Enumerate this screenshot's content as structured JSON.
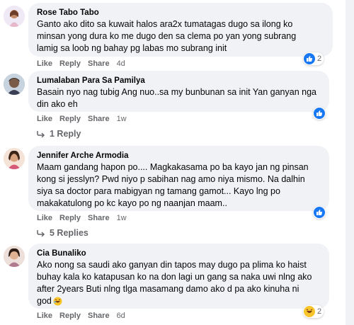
{
  "comments": [
    {
      "author": "Rose Tabo Tabo",
      "lines": [
        "Ganto ako dito sa kuwait halos ara2x tumatagas dugo sa ilong ko",
        "minsan yong dura ko me dugo den sa clema po yan yong subrang",
        "lamig sa loob ng bahay pg labas mo subrang init"
      ],
      "actions": {
        "like": "Like",
        "reply": "Reply",
        "share": "Share",
        "time": "4d"
      },
      "reaction_icons": [
        "like-icon",
        "heart-icon"
      ],
      "reaction_count": "2"
    },
    {
      "author": "Lumalaban Para Sa Pamilya",
      "lines": [
        "Basain nyo nag tubig Ang nuo..sa my bunbunan sa init Yan ganyan nga",
        "din ako eh"
      ],
      "actions": {
        "like": "Like",
        "reply": "Reply",
        "share": "Share",
        "time": "1w"
      },
      "reaction_icons": [
        "like-icon"
      ],
      "replies_label": "1 Reply"
    },
    {
      "author": "Jennifer Arche Armodia",
      "lines": [
        "Maam gandang hapon po.... Magkakasama po ba kayo jan ng pinsan",
        "kong si jesslyn? Pwd niyo p sabihan nag amo niya mismo. Na dalhin",
        "siya sa doctor para mabigyan ng tamang gamot... Kayo lng po",
        "makakatulong po kc kayo po ng naanjan maam.."
      ],
      "actions": {
        "like": "Like",
        "reply": "Reply",
        "share": "Share",
        "time": "1w"
      },
      "reaction_icons": [
        "like-icon"
      ],
      "replies_label": "5 Replies"
    },
    {
      "author": "Cia Bunaliko",
      "lines": [
        "Ako nong sa saudi ako ganyan din tapos may dugo pa plima ko haist",
        "buhay kala ko katapusan ko na don lagi un gang sa naka uwi nlng ako",
        "after 2years Buti nlng tlga masamang damo ako d pa ako kinuha ni",
        "god"
      ],
      "actions": {
        "like": "Like",
        "reply": "Reply",
        "share": "Share",
        "time": "6d"
      },
      "reaction_icons": [
        "haha-icon"
      ],
      "reaction_count": "2"
    }
  ],
  "colors": {
    "bubble": "#f0f2f5",
    "meta": "#65676b",
    "like_blue": "#1877f2",
    "heart_red": "#f33e58",
    "haha_yellow": "#f7c42b"
  }
}
